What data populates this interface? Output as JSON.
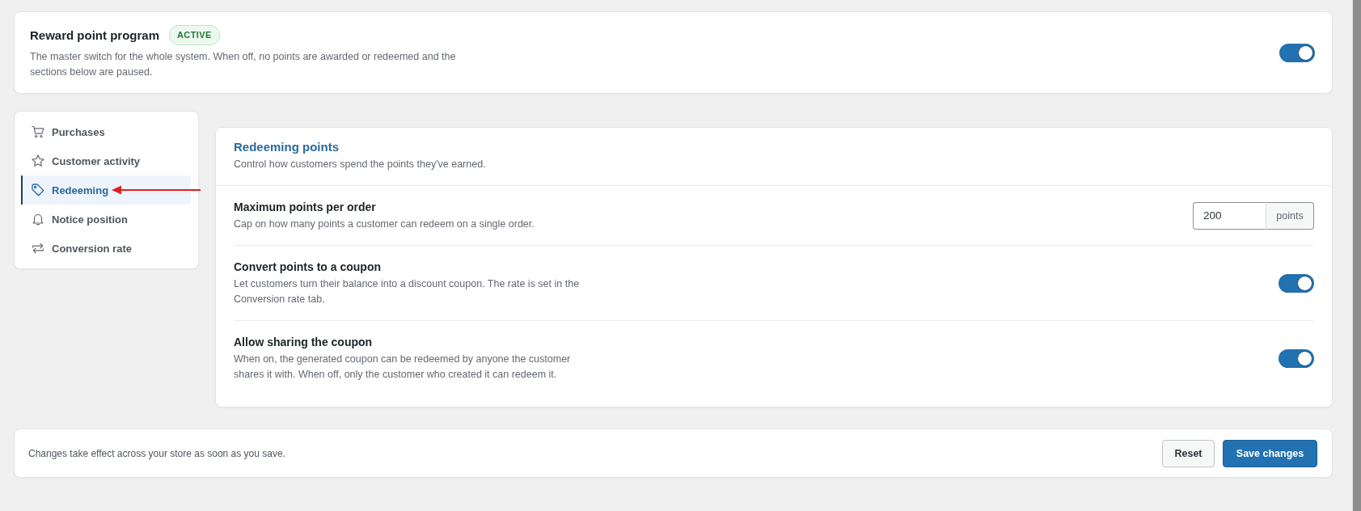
{
  "program": {
    "title": "Reward point program",
    "badge": "ACTIVE",
    "description": "The master switch for the whole system. When off, no points are awarded or redeemed and the sections below are paused.",
    "on": true
  },
  "sidebar": {
    "items": [
      {
        "label": "Purchases",
        "selected": false
      },
      {
        "label": "Customer activity",
        "selected": false
      },
      {
        "label": "Redeeming",
        "selected": true
      },
      {
        "label": "Notice position",
        "selected": false
      },
      {
        "label": "Conversion rate",
        "selected": false
      }
    ]
  },
  "section": {
    "title": "Redeeming points",
    "subtitle": "Control how customers spend the points they've earned.",
    "settings": [
      {
        "kind": "number",
        "title": "Maximum points per order",
        "description": "Cap on how many points a customer can redeem on a single order.",
        "value": "200",
        "unit": "points"
      },
      {
        "kind": "toggle",
        "title": "Convert points to a coupon",
        "description": "Let customers turn their balance into a discount coupon. The rate is set in the Conversion rate tab.",
        "on": true
      },
      {
        "kind": "toggle",
        "title": "Allow sharing the coupon",
        "description": "When on, the generated coupon can be redeemed by anyone the customer shares it with. When off, only the customer who created it can redeem it.",
        "on": true
      }
    ]
  },
  "footer": {
    "note": "Changes take effect across your store as soon as you save.",
    "buttons": [
      {
        "label": "Reset",
        "kind": "secondary"
      },
      {
        "label": "Save changes",
        "kind": "primary"
      }
    ]
  }
}
